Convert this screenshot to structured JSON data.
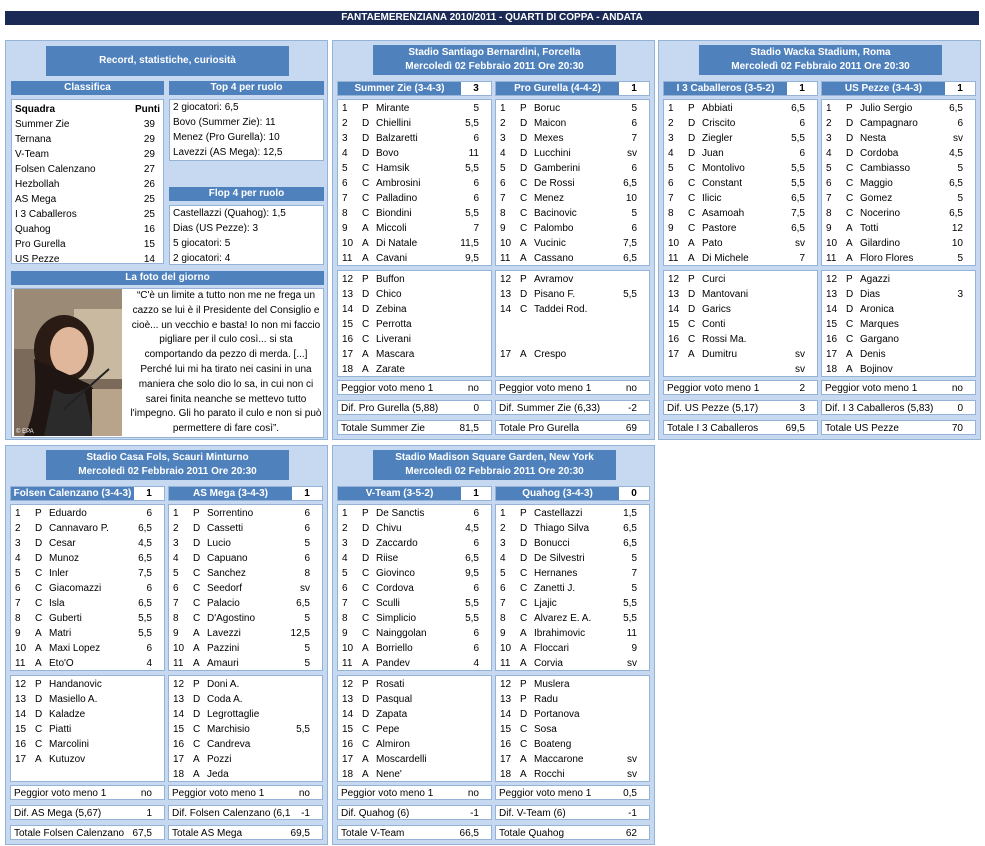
{
  "page_title": "FANTAEMERENZIANA 2010/2011 - QUARTI DI COPPA - ANDATA",
  "left": {
    "header": "Record, statistiche, curiosità",
    "classifica": {
      "title": "Classifica",
      "col_team": "Squadra",
      "col_points": "Punti",
      "rows": [
        {
          "team": "Summer Zie",
          "pts": "39"
        },
        {
          "team": "Ternana",
          "pts": "29"
        },
        {
          "team": "V-Team",
          "pts": "29"
        },
        {
          "team": "Folsen Calenzano",
          "pts": "27"
        },
        {
          "team": "Hezbollah",
          "pts": "26"
        },
        {
          "team": "AS Mega",
          "pts": "25"
        },
        {
          "team": "I 3 Caballeros",
          "pts": "25"
        },
        {
          "team": "Quahog",
          "pts": "16"
        },
        {
          "team": "Pro Gurella",
          "pts": "15"
        },
        {
          "team": "US Pezze",
          "pts": "14"
        }
      ]
    },
    "top": {
      "title": "Top 4 per ruolo",
      "lines": [
        "2 giocatori: 6,5",
        "Bovo (Summer Zie): 11",
        "Menez (Pro Gurella): 10",
        "Lavezzi (AS Mega): 12,5"
      ]
    },
    "flop": {
      "title": "Flop 4 per ruolo",
      "lines": [
        "Castellazzi (Quahog): 1,5",
        "Dias (US Pezze): 3",
        "5 giocatori: 5",
        "2 giocatori: 4"
      ]
    },
    "foto": {
      "title": "La foto del giorno",
      "caption": "© EPA",
      "quote": "“C'è un limite a tutto non me ne frega un cazzo se lui è il Presidente del Consiglio e cioè... un vecchio e basta! Io non mi faccio pigliare per il culo così... si sta comportando da pezzo di merda. [...] Perché lui mi ha tirato nei casini in una maniera che solo dio lo sa, in cui non ci sarei finita neanche se mettevo tutto l'impegno. Gli ho parato il culo e non si può permettere di fare così”."
    }
  },
  "matches": [
    {
      "venue": "Stadio Santiago Bernardini, Forcella",
      "date": "Mercoledì 02 Febbraio 2011 Ore 20:30",
      "home": {
        "name": "Summer Zie (3-4-3)",
        "score": "3",
        "starters": [
          [
            "1",
            "P",
            "Mirante",
            "5"
          ],
          [
            "2",
            "D",
            "Chiellini",
            "5,5"
          ],
          [
            "3",
            "D",
            "Balzaretti",
            "6"
          ],
          [
            "4",
            "D",
            "Bovo",
            "11"
          ],
          [
            "5",
            "C",
            "Hamsik",
            "5,5"
          ],
          [
            "6",
            "C",
            "Ambrosini",
            "6"
          ],
          [
            "7",
            "C",
            "Palladino",
            "6"
          ],
          [
            "8",
            "C",
            "Biondini",
            "5,5"
          ],
          [
            "9",
            "A",
            "Miccoli",
            "7"
          ],
          [
            "10",
            "A",
            "Di Natale",
            "11,5"
          ],
          [
            "11",
            "A",
            "Cavani",
            "9,5"
          ]
        ],
        "bench": [
          [
            "12",
            "P",
            "Buffon",
            ""
          ],
          [
            "13",
            "D",
            "Chico",
            ""
          ],
          [
            "14",
            "D",
            "Zebina",
            ""
          ],
          [
            "15",
            "C",
            "Perrotta",
            ""
          ],
          [
            "16",
            "C",
            "Liverani",
            ""
          ],
          [
            "17",
            "A",
            "Mascara",
            ""
          ],
          [
            "18",
            "A",
            "Zarate",
            ""
          ]
        ],
        "peggior_label": "Peggior voto meno 1",
        "peggior_val": "no",
        "dif_label": "Dif. Pro Gurella (5,88)",
        "dif_val": "0",
        "tot_label": "Totale Summer Zie",
        "tot_val": "81,5"
      },
      "away": {
        "name": "Pro Gurella (4-4-2)",
        "score": "1",
        "starters": [
          [
            "1",
            "P",
            "Boruc",
            "5"
          ],
          [
            "2",
            "D",
            "Maicon",
            "6"
          ],
          [
            "3",
            "D",
            "Mexes",
            "7"
          ],
          [
            "4",
            "D",
            "Lucchini",
            "sv"
          ],
          [
            "5",
            "D",
            "Gamberini",
            "6"
          ],
          [
            "6",
            "C",
            "De Rossi",
            "6,5"
          ],
          [
            "7",
            "C",
            "Menez",
            "10"
          ],
          [
            "8",
            "C",
            "Bacinovic",
            "5"
          ],
          [
            "9",
            "C",
            "Palombo",
            "6"
          ],
          [
            "10",
            "A",
            "Vucinic",
            "7,5"
          ],
          [
            "11",
            "A",
            "Cassano",
            "6,5"
          ]
        ],
        "bench": [
          [
            "12",
            "P",
            "Avramov",
            ""
          ],
          [
            "13",
            "D",
            "Pisano F.",
            "5,5"
          ],
          [
            "14",
            "C",
            "Taddei Rod.",
            ""
          ],
          [
            "",
            "",
            "",
            ""
          ],
          [
            "",
            "",
            "",
            ""
          ],
          [
            "17",
            "A",
            "Crespo",
            ""
          ],
          [
            "",
            "",
            "",
            ""
          ]
        ],
        "peggior_label": "Peggior voto meno 1",
        "peggior_val": "no",
        "dif_label": "Dif. Summer Zie (6,33)",
        "dif_val": "-2",
        "tot_label": "Totale Pro Gurella",
        "tot_val": "69"
      }
    },
    {
      "venue": "Stadio Wacka Stadium, Roma",
      "date": "Mercoledì 02 Febbraio 2011 Ore 20:30",
      "home": {
        "name": "I 3 Caballeros (3-5-2)",
        "score": "1",
        "starters": [
          [
            "1",
            "P",
            "Abbiati",
            "6,5"
          ],
          [
            "2",
            "D",
            "Criscito",
            "6"
          ],
          [
            "3",
            "D",
            "Ziegler",
            "5,5"
          ],
          [
            "4",
            "D",
            "Juan",
            "6"
          ],
          [
            "5",
            "C",
            "Montolivo",
            "5,5"
          ],
          [
            "6",
            "C",
            "Constant",
            "5,5"
          ],
          [
            "7",
            "C",
            "Ilicic",
            "6,5"
          ],
          [
            "8",
            "C",
            "Asamoah",
            "7,5"
          ],
          [
            "9",
            "C",
            "Pastore",
            "6,5"
          ],
          [
            "10",
            "A",
            "Pato",
            "sv"
          ],
          [
            "11",
            "A",
            "Di Michele",
            "7"
          ]
        ],
        "bench": [
          [
            "12",
            "P",
            "Curci",
            ""
          ],
          [
            "13",
            "D",
            "Mantovani",
            ""
          ],
          [
            "14",
            "D",
            "Garics",
            ""
          ],
          [
            "15",
            "C",
            "Conti",
            ""
          ],
          [
            "16",
            "C",
            "Rossi Ma.",
            ""
          ],
          [
            "17",
            "A",
            "Dumitru",
            "sv"
          ],
          [
            "",
            "",
            "",
            "sv"
          ]
        ],
        "peggior_label": "Peggior voto meno 1",
        "peggior_val": "2",
        "dif_label": "Dif. US Pezze (5,17)",
        "dif_val": "3",
        "tot_label": "Totale I 3 Caballeros",
        "tot_val": "69,5"
      },
      "away": {
        "name": "US Pezze (3-4-3)",
        "score": "1",
        "starters": [
          [
            "1",
            "P",
            "Julio Sergio",
            "6,5"
          ],
          [
            "2",
            "D",
            "Campagnaro",
            "6"
          ],
          [
            "3",
            "D",
            "Nesta",
            "sv"
          ],
          [
            "4",
            "D",
            "Cordoba",
            "4,5"
          ],
          [
            "5",
            "C",
            "Cambiasso",
            "5"
          ],
          [
            "6",
            "C",
            "Maggio",
            "6,5"
          ],
          [
            "7",
            "C",
            "Gomez",
            "5"
          ],
          [
            "8",
            "C",
            "Nocerino",
            "6,5"
          ],
          [
            "9",
            "A",
            "Totti",
            "12"
          ],
          [
            "10",
            "A",
            "Gilardino",
            "10"
          ],
          [
            "11",
            "A",
            "Floro Flores",
            "5"
          ]
        ],
        "bench": [
          [
            "12",
            "P",
            "Agazzi",
            ""
          ],
          [
            "13",
            "D",
            "Dias",
            "3"
          ],
          [
            "14",
            "D",
            "Aronica",
            ""
          ],
          [
            "15",
            "C",
            "Marques",
            ""
          ],
          [
            "16",
            "C",
            "Gargano",
            ""
          ],
          [
            "17",
            "A",
            "Denis",
            ""
          ],
          [
            "18",
            "A",
            "Bojinov",
            ""
          ]
        ],
        "peggior_label": "Peggior voto meno 1",
        "peggior_val": "no",
        "dif_label": "Dif. I 3 Caballeros (5,83)",
        "dif_val": "0",
        "tot_label": "Totale US Pezze",
        "tot_val": "70"
      }
    },
    {
      "venue": "Stadio Casa Fols, Scauri Minturno",
      "date": "Mercoledì 02 Febbraio 2011 Ore 20:30",
      "home": {
        "name": "Folsen Calenzano (3-4-3)",
        "score": "1",
        "starters": [
          [
            "1",
            "P",
            "Eduardo",
            "6"
          ],
          [
            "2",
            "D",
            "Cannavaro P.",
            "6,5"
          ],
          [
            "3",
            "D",
            "Cesar",
            "4,5"
          ],
          [
            "4",
            "D",
            "Munoz",
            "6,5"
          ],
          [
            "5",
            "C",
            "Inler",
            "7,5"
          ],
          [
            "6",
            "C",
            "Giacomazzi",
            "6"
          ],
          [
            "7",
            "C",
            "Isla",
            "6,5"
          ],
          [
            "8",
            "C",
            "Guberti",
            "5,5"
          ],
          [
            "9",
            "A",
            "Matri",
            "5,5"
          ],
          [
            "10",
            "A",
            "Maxi Lopez",
            "6"
          ],
          [
            "11",
            "A",
            "Eto'O",
            "4"
          ]
        ],
        "bench": [
          [
            "12",
            "P",
            "Handanovic",
            ""
          ],
          [
            "13",
            "D",
            "Masiello A.",
            ""
          ],
          [
            "14",
            "D",
            "Kaladze",
            ""
          ],
          [
            "15",
            "C",
            "Piatti",
            ""
          ],
          [
            "16",
            "C",
            "Marcolini",
            ""
          ],
          [
            "17",
            "A",
            "Kutuzov",
            ""
          ],
          [
            "",
            "",
            "",
            ""
          ]
        ],
        "peggior_label": "Peggior voto meno 1",
        "peggior_val": "no",
        "dif_label": "Dif. AS Mega (5,67)",
        "dif_val": "1",
        "tot_label": "Totale Folsen Calenzano",
        "tot_val": "67,5"
      },
      "away": {
        "name": "AS Mega (3-4-3)",
        "score": "1",
        "starters": [
          [
            "1",
            "P",
            "Sorrentino",
            "6"
          ],
          [
            "2",
            "D",
            "Cassetti",
            "6"
          ],
          [
            "3",
            "D",
            "Lucio",
            "5"
          ],
          [
            "4",
            "D",
            "Capuano",
            "6"
          ],
          [
            "5",
            "C",
            "Sanchez",
            "8"
          ],
          [
            "6",
            "C",
            "Seedorf",
            "sv"
          ],
          [
            "7",
            "C",
            "Palacio",
            "6,5"
          ],
          [
            "8",
            "C",
            "D'Agostino",
            "5"
          ],
          [
            "9",
            "A",
            "Lavezzi",
            "12,5"
          ],
          [
            "10",
            "A",
            "Pazzini",
            "5"
          ],
          [
            "11",
            "A",
            "Amauri",
            "5"
          ]
        ],
        "bench": [
          [
            "12",
            "P",
            "Doni A.",
            ""
          ],
          [
            "13",
            "D",
            "Coda A.",
            ""
          ],
          [
            "14",
            "D",
            "Legrottaglie",
            ""
          ],
          [
            "15",
            "C",
            "Marchisio",
            "5,5"
          ],
          [
            "16",
            "C",
            "Candreva",
            ""
          ],
          [
            "17",
            "A",
            "Pozzi",
            ""
          ],
          [
            "18",
            "A",
            "Jeda",
            ""
          ]
        ],
        "peggior_label": "Peggior voto meno 1",
        "peggior_val": "no",
        "dif_label": "Dif. Folsen Calenzano (6,1",
        "dif_val": "-1",
        "tot_label": "Totale AS Mega",
        "tot_val": "69,5"
      }
    },
    {
      "venue": "Stadio Madison Square Garden, New York",
      "date": "Mercoledì 02 Febbraio 2011 Ore 20:30",
      "home": {
        "name": "V-Team (3-5-2)",
        "score": "1",
        "starters": [
          [
            "1",
            "P",
            "De Sanctis",
            "6"
          ],
          [
            "2",
            "D",
            "Chivu",
            "4,5"
          ],
          [
            "3",
            "D",
            "Zaccardo",
            "6"
          ],
          [
            "4",
            "D",
            "Riise",
            "6,5"
          ],
          [
            "5",
            "C",
            "Giovinco",
            "9,5"
          ],
          [
            "6",
            "C",
            "Cordova",
            "6"
          ],
          [
            "7",
            "C",
            "Sculli",
            "5,5"
          ],
          [
            "8",
            "C",
            "Simplicio",
            "5,5"
          ],
          [
            "9",
            "C",
            "Nainggolan",
            "6"
          ],
          [
            "10",
            "A",
            "Borriello",
            "6"
          ],
          [
            "11",
            "A",
            "Pandev",
            "4"
          ]
        ],
        "bench": [
          [
            "12",
            "P",
            "Rosati",
            ""
          ],
          [
            "13",
            "D",
            "Pasqual",
            ""
          ],
          [
            "14",
            "D",
            "Zapata",
            ""
          ],
          [
            "15",
            "C",
            "Pepe",
            ""
          ],
          [
            "16",
            "C",
            "Almiron",
            ""
          ],
          [
            "17",
            "A",
            "Moscardelli",
            ""
          ],
          [
            "18",
            "A",
            "Nene'",
            ""
          ]
        ],
        "peggior_label": "Peggior voto meno 1",
        "peggior_val": "no",
        "dif_label": "Dif. Quahog (6)",
        "dif_val": "-1",
        "tot_label": "Totale V-Team",
        "tot_val": "66,5"
      },
      "away": {
        "name": "Quahog (3-4-3)",
        "score": "0",
        "starters": [
          [
            "1",
            "P",
            "Castellazzi",
            "1,5"
          ],
          [
            "2",
            "D",
            "Thiago Silva",
            "6,5"
          ],
          [
            "3",
            "D",
            "Bonucci",
            "6,5"
          ],
          [
            "4",
            "D",
            "De Silvestri",
            "5"
          ],
          [
            "5",
            "C",
            "Hernanes",
            "7"
          ],
          [
            "6",
            "C",
            "Zanetti J.",
            "5"
          ],
          [
            "7",
            "C",
            "Ljajic",
            "5,5"
          ],
          [
            "8",
            "C",
            "Alvarez E. A.",
            "5,5"
          ],
          [
            "9",
            "A",
            "Ibrahimovic",
            "11"
          ],
          [
            "10",
            "A",
            "Floccari",
            "9"
          ],
          [
            "11",
            "A",
            "Corvia",
            "sv"
          ]
        ],
        "bench": [
          [
            "12",
            "P",
            "Muslera",
            ""
          ],
          [
            "13",
            "P",
            "Radu",
            ""
          ],
          [
            "14",
            "D",
            "Portanova",
            ""
          ],
          [
            "15",
            "C",
            "Sosa",
            ""
          ],
          [
            "16",
            "C",
            "Boateng",
            ""
          ],
          [
            "17",
            "A",
            "Maccarone",
            "sv"
          ],
          [
            "18",
            "A",
            "Rocchi",
            "sv"
          ]
        ],
        "peggior_label": "Peggior voto meno 1",
        "peggior_val": "0,5",
        "dif_label": "Dif. V-Team (6)",
        "dif_val": "-1",
        "tot_label": "Totale Quahog",
        "tot_val": "62"
      }
    }
  ]
}
